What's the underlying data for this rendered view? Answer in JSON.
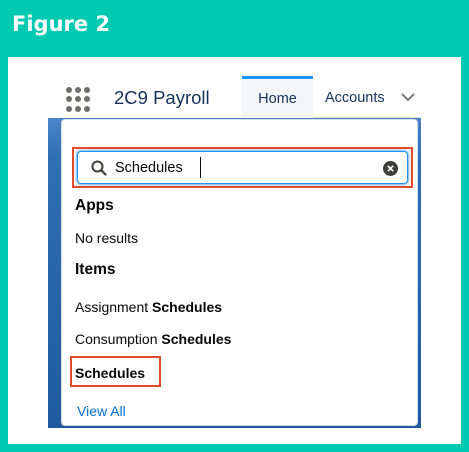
{
  "figure": {
    "title": "Figure 2"
  },
  "header": {
    "app_name": "2C9 Payroll",
    "tabs": [
      {
        "label": "Home",
        "active": true
      },
      {
        "label": "Accounts",
        "has_dropdown": true
      }
    ]
  },
  "search": {
    "value": "Schedules",
    "icon": "search-icon",
    "clear_icon": "clear-icon"
  },
  "sections": {
    "apps": {
      "heading": "Apps",
      "empty_text": "No results"
    },
    "items": {
      "heading": "Items",
      "results": [
        {
          "prefix": "Assignment ",
          "match": "Schedules"
        },
        {
          "prefix": "Consumption ",
          "match": "Schedules"
        },
        {
          "prefix": "",
          "match": "Schedules"
        }
      ]
    }
  },
  "footer": {
    "view_all": "View All"
  },
  "colors": {
    "figure_bg": "#00c9b2",
    "highlight_red": "#e14b2c",
    "link_blue": "#0070d2",
    "banner_blue": "#2a6bb3"
  }
}
